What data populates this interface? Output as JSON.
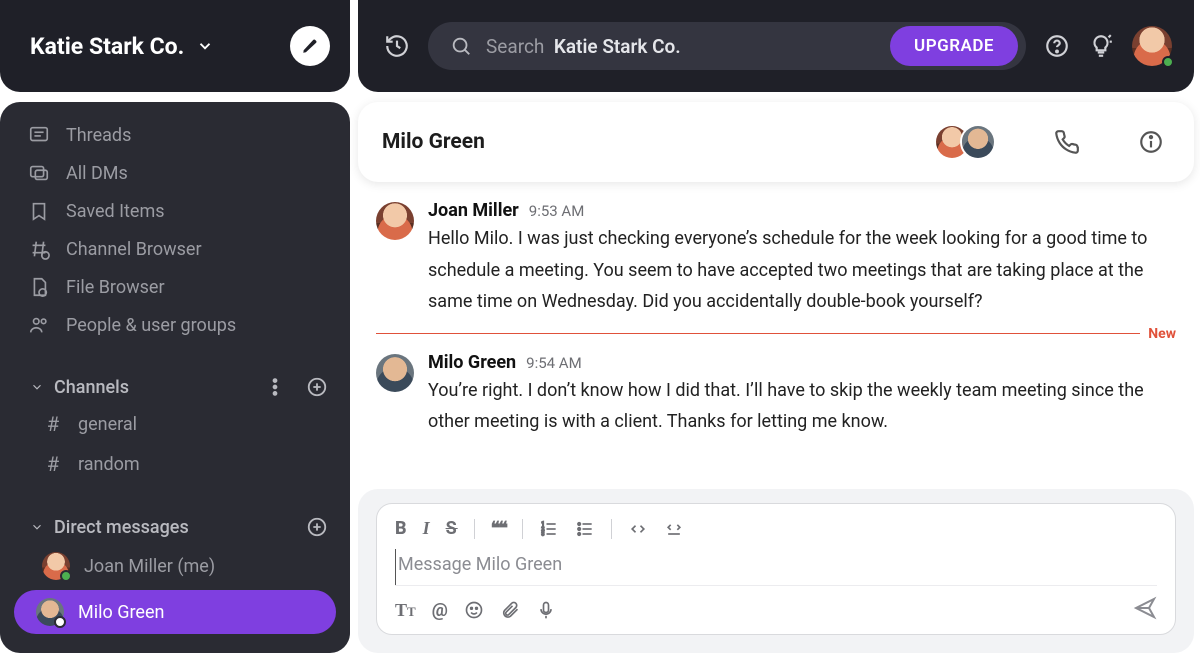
{
  "workspace": {
    "name": "Katie Stark Co."
  },
  "sidebar": {
    "nav": [
      {
        "label": "Threads"
      },
      {
        "label": "All DMs"
      },
      {
        "label": "Saved Items"
      },
      {
        "label": "Channel Browser"
      },
      {
        "label": "File Browser"
      },
      {
        "label": "People & user groups"
      }
    ],
    "channels_header": "Channels",
    "channels": [
      {
        "name": "general"
      },
      {
        "name": "random"
      }
    ],
    "dms_header": "Direct messages",
    "dms": [
      {
        "name": "Joan Miller (me)"
      },
      {
        "name": "Milo Green"
      }
    ]
  },
  "topbar": {
    "search_prefix": "Search",
    "search_workspace": "Katie Stark Co.",
    "upgrade": "UPGRADE"
  },
  "chat": {
    "title": "Milo Green",
    "new_label": "New",
    "messages": [
      {
        "author": "Joan Miller",
        "time": "9:53 AM",
        "text": "Hello Milo. I was just checking everyone’s schedule for the week looking for a good time to schedule a meeting. You seem to have accepted two meetings that are taking place at the same time on Wednesday. Did you accidentally double-book yourself?"
      },
      {
        "author": "Milo Green",
        "time": "9:54 AM",
        "text": "You’re right. I don’t know how I did that. I’ll have to skip the weekly team meeting since the other meeting is with a client. Thanks for letting me know."
      }
    ]
  },
  "composer": {
    "placeholder": "Message Milo Green"
  }
}
